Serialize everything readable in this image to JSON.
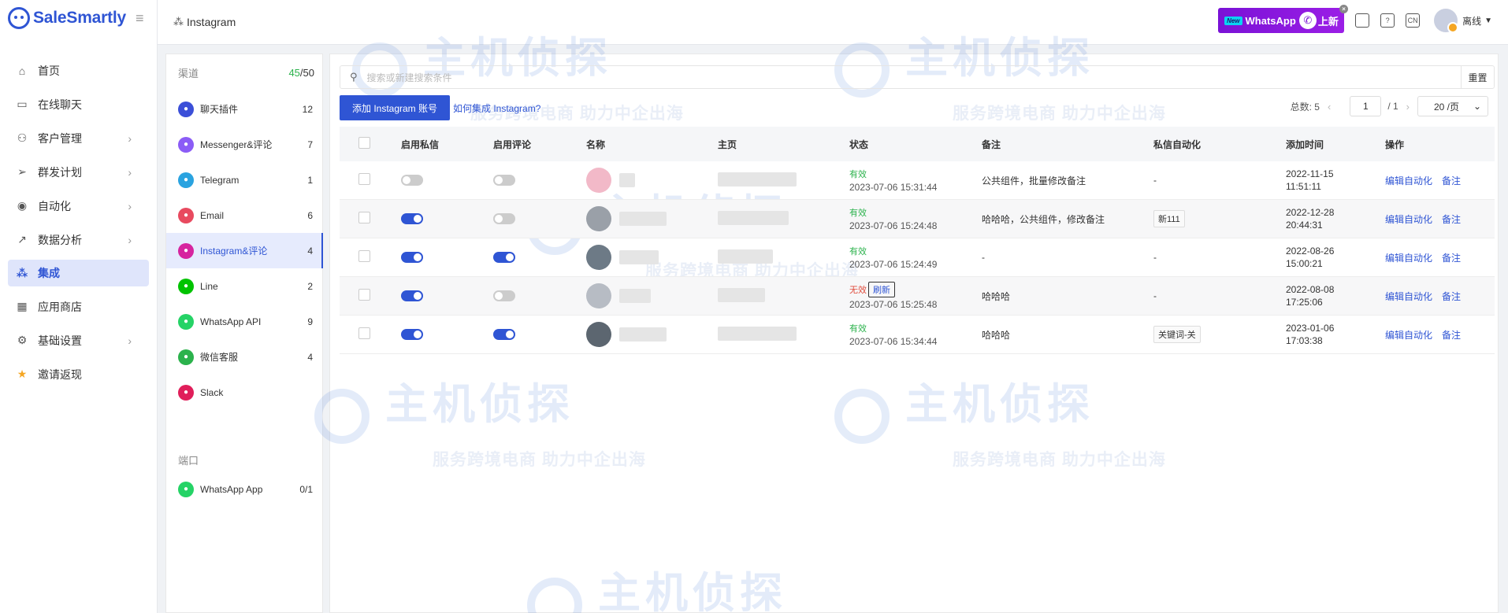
{
  "app": {
    "name": "SaleSmartly"
  },
  "sidebar": {
    "items": [
      {
        "label": "首页",
        "icon": "home-icon"
      },
      {
        "label": "在线聊天",
        "icon": "chat-icon"
      },
      {
        "label": "客户管理",
        "icon": "users-icon"
      },
      {
        "label": "群发计划",
        "icon": "send-icon"
      },
      {
        "label": "自动化",
        "icon": "robot-icon"
      },
      {
        "label": "数据分析",
        "icon": "chart-icon"
      },
      {
        "label": "集成",
        "icon": "integration-icon"
      },
      {
        "label": "应用商店",
        "icon": "apps-icon"
      },
      {
        "label": "基础设置",
        "icon": "gear-icon"
      },
      {
        "label": "邀请返现",
        "icon": "star-icon"
      }
    ]
  },
  "header": {
    "breadcrumb": "Instagram",
    "banner": {
      "badge": "New",
      "text": "WhatsApp",
      "suffix": "上新"
    },
    "icons": [
      "book-icon",
      "help-icon",
      "language-icon"
    ],
    "lang_short": "CN",
    "status": "离线"
  },
  "channels": {
    "title": "渠道",
    "used": "45",
    "total": "/50",
    "items": [
      {
        "label": "聊天插件",
        "count": "12",
        "color": "#3b4fd8"
      },
      {
        "label": "Messenger&评论",
        "count": "7",
        "color": "#8b5cf6"
      },
      {
        "label": "Telegram",
        "count": "1",
        "color": "#2aa3e0"
      },
      {
        "label": "Email",
        "count": "6",
        "color": "#e84a5f"
      },
      {
        "label": "Instagram&评论",
        "count": "4",
        "color": "#d6249f"
      },
      {
        "label": "Line",
        "count": "2",
        "color": "#00c300"
      },
      {
        "label": "WhatsApp API",
        "count": "9",
        "color": "#25d366"
      },
      {
        "label": "微信客服",
        "count": "4",
        "color": "#2bb24c"
      },
      {
        "label": "Slack",
        "count": "",
        "color": "#e01e5a"
      }
    ],
    "port_title": "端口",
    "port_items": [
      {
        "label": "WhatsApp App",
        "count": "0/1",
        "color": "#25d366"
      }
    ]
  },
  "main": {
    "search_placeholder": "搜索或新建搜索条件",
    "reset": "重置",
    "add_button": "添加 Instagram 账号",
    "howto": "如何集成 Instagram?",
    "pager": {
      "total_label": "总数: 5",
      "page": "1",
      "pages": "/ 1",
      "size": "20 /页"
    },
    "columns": [
      "启用私信",
      "启用评论",
      "名称",
      "主页",
      "状态",
      "备注",
      "私信自动化",
      "添加时间",
      "操作"
    ],
    "rows": [
      {
        "dm": false,
        "comment": false,
        "status": "有效",
        "status_ok": true,
        "status_time": "2023-07-06 15:31:44",
        "note": "公共组件，批量修改备注",
        "auto": "-",
        "auto_tag": false,
        "added_date": "2022-11-15",
        "added_time": "11:51:11"
      },
      {
        "dm": true,
        "comment": false,
        "status": "有效",
        "status_ok": true,
        "status_time": "2023-07-06 15:24:48",
        "note": "哈哈哈，公共组件，修改备注",
        "auto": "新111",
        "auto_tag": true,
        "added_date": "2022-12-28",
        "added_time": "20:44:31"
      },
      {
        "dm": true,
        "comment": true,
        "status": "有效",
        "status_ok": true,
        "status_time": "2023-07-06 15:24:49",
        "note": "-",
        "auto": "-",
        "auto_tag": false,
        "added_date": "2022-08-26",
        "added_time": "15:00:21"
      },
      {
        "dm": true,
        "comment": false,
        "status": "无效",
        "status_ok": false,
        "status_time": "2023-07-06 15:25:48",
        "note": "哈哈哈",
        "auto": "-",
        "auto_tag": false,
        "added_date": "2022-08-08",
        "added_time": "17:25:06"
      },
      {
        "dm": true,
        "comment": true,
        "status": "有效",
        "status_ok": true,
        "status_time": "2023-07-06 15:34:44",
        "note": "哈哈哈",
        "auto": "关键词-关",
        "auto_tag": true,
        "added_date": "2023-01-06",
        "added_time": "17:03:38"
      }
    ],
    "refresh_label": "刷新",
    "action_edit": "编辑自动化",
    "action_note": "备注"
  },
  "watermark": {
    "big": "主机侦探",
    "small": "服务跨境电商 助力中企出海"
  },
  "colors": {
    "primary": "#2f55d4",
    "success": "#2bb24c",
    "danger": "#e04a3a",
    "banner": "#8a17dd"
  }
}
